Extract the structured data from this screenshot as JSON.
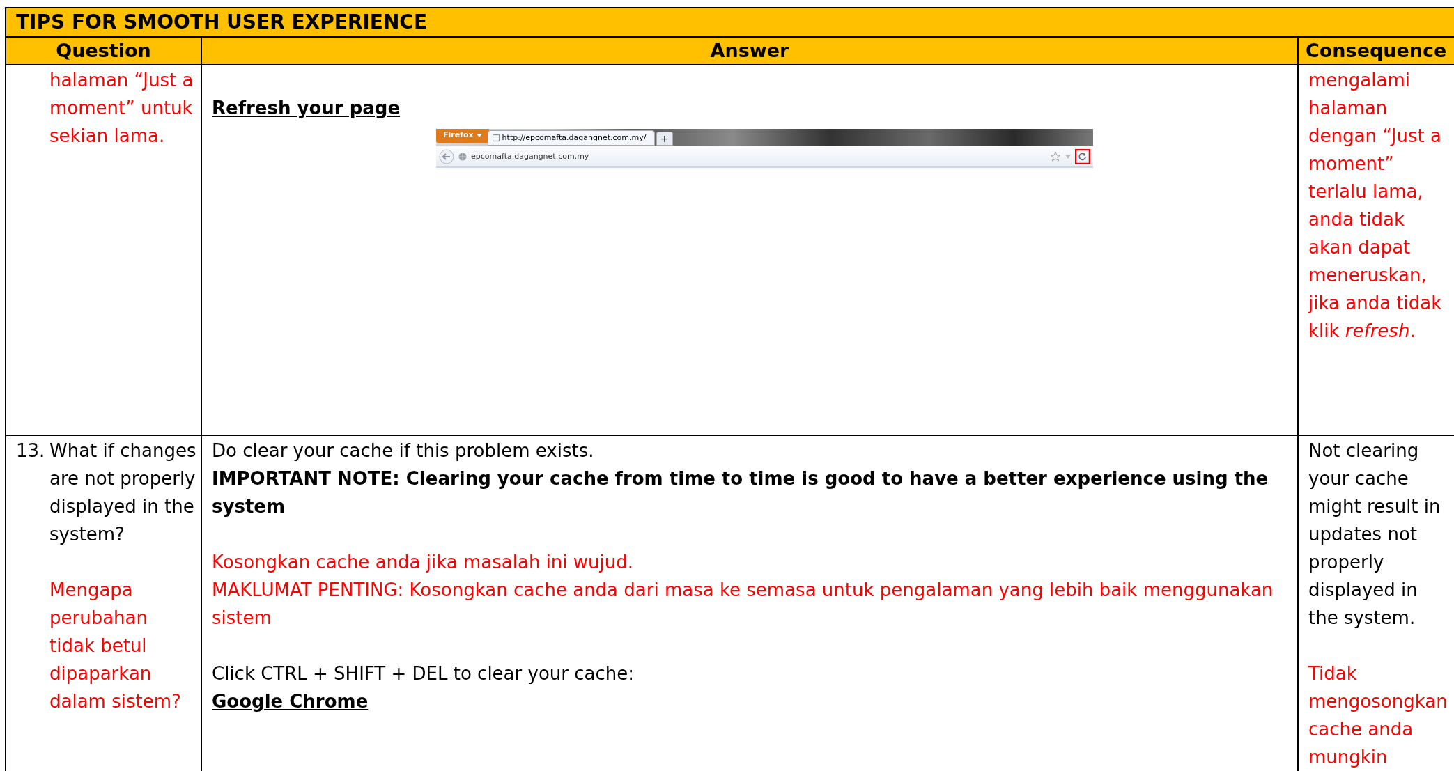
{
  "title": "TIPS FOR SMOOTH USER EXPERIENCE",
  "columns": [
    "Question",
    "Answer",
    "Consequence"
  ],
  "rows": [
    {
      "question": [
        {
          "kind": "malay",
          "text": "halaman “Just a moment” untuk sekian lama."
        }
      ],
      "answer": [
        [
          {
            "kind": "heading",
            "text": "Refresh your page"
          },
          {
            "kind": "browser",
            "menu_button": "Firefox",
            "tab_title": "http://epcomafta.dagangnet.com.my/",
            "new_tab": "+",
            "address": "epcomafta.dagangnet.com.my"
          }
        ]
      ],
      "consequence": [
        [
          {
            "kind": "malay",
            "text": "mengalami halaman dengan “Just a moment” terlalu lama, anda tidak akan dapat meneruskan, jika anda tidak klik *refresh*."
          }
        ]
      ]
    },
    {
      "number": "13.",
      "question": [
        {
          "kind": "english",
          "text": "What if changes are not properly displayed in the system?"
        },
        {
          "kind": "malay",
          "text": "Mengapa perubahan tidak betul dipaparkan dalam sistem?"
        }
      ],
      "answer": [
        [
          {
            "kind": "english",
            "text": "Do clear your cache if this problem exists."
          },
          {
            "kind": "note",
            "text": "IMPORTANT NOTE: Clearing your cache from time to time is good to have a better experience using the system"
          }
        ],
        [
          {
            "kind": "malay",
            "text": "Kosongkan cache anda jika masalah ini wujud."
          },
          {
            "kind": "malay",
            "text": "MAKLUMAT PENTING: Kosongkan cache anda dari masa ke semasa untuk pengalaman yang lebih baik menggunakan sistem"
          }
        ],
        [
          {
            "kind": "english",
            "text": "Click CTRL + SHIFT + DEL to clear your cache:"
          },
          {
            "kind": "heading",
            "text": "Google Chrome"
          }
        ]
      ],
      "consequence": [
        [
          {
            "kind": "english",
            "text": "Not clearing your cache might result in updates not properly displayed in the system."
          }
        ],
        [
          {
            "kind": "malay",
            "text": "Tidak mengosongkan cache anda mungkin"
          }
        ]
      ]
    }
  ]
}
